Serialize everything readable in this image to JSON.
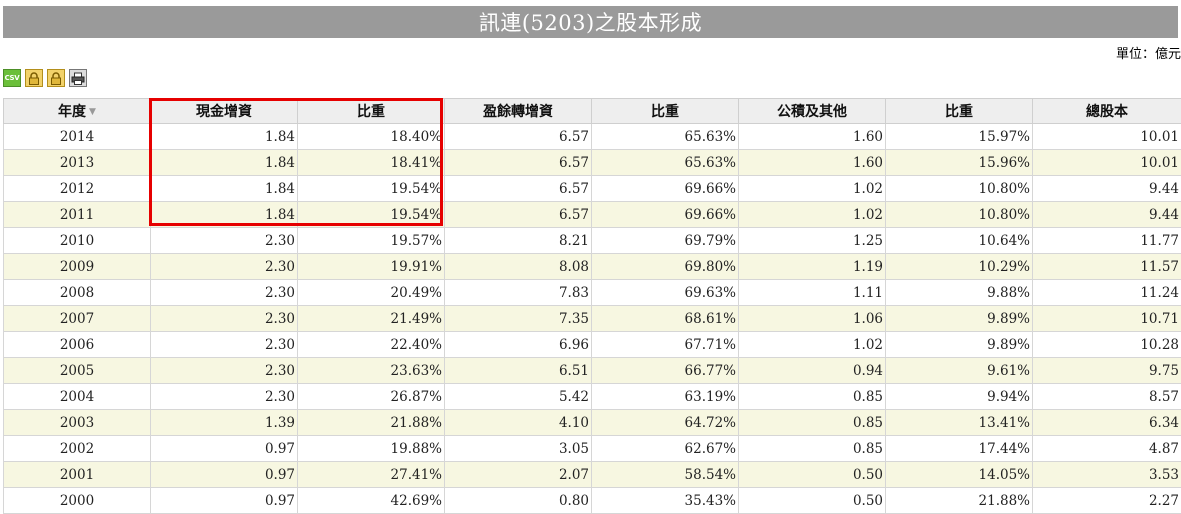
{
  "title": "訊連(5203)之股本形成",
  "unit_label": "單位：億元",
  "toolbar": {
    "csv_label": "CSV"
  },
  "table": {
    "headers": [
      "年度",
      "現金增資",
      "比重",
      "盈餘轉增資",
      "比重",
      "公積及其他",
      "比重",
      "總股本"
    ],
    "rows": [
      [
        "2014",
        "1.84",
        "18.40%",
        "6.57",
        "65.63%",
        "1.60",
        "15.97%",
        "10.01"
      ],
      [
        "2013",
        "1.84",
        "18.41%",
        "6.57",
        "65.63%",
        "1.60",
        "15.96%",
        "10.01"
      ],
      [
        "2012",
        "1.84",
        "19.54%",
        "6.57",
        "69.66%",
        "1.02",
        "10.80%",
        "9.44"
      ],
      [
        "2011",
        "1.84",
        "19.54%",
        "6.57",
        "69.66%",
        "1.02",
        "10.80%",
        "9.44"
      ],
      [
        "2010",
        "2.30",
        "19.57%",
        "8.21",
        "69.79%",
        "1.25",
        "10.64%",
        "11.77"
      ],
      [
        "2009",
        "2.30",
        "19.91%",
        "8.08",
        "69.80%",
        "1.19",
        "10.29%",
        "11.57"
      ],
      [
        "2008",
        "2.30",
        "20.49%",
        "7.83",
        "69.63%",
        "1.11",
        "9.88%",
        "11.24"
      ],
      [
        "2007",
        "2.30",
        "21.49%",
        "7.35",
        "68.61%",
        "1.06",
        "9.89%",
        "10.71"
      ],
      [
        "2006",
        "2.30",
        "22.40%",
        "6.96",
        "67.71%",
        "1.02",
        "9.89%",
        "10.28"
      ],
      [
        "2005",
        "2.30",
        "23.63%",
        "6.51",
        "66.77%",
        "0.94",
        "9.61%",
        "9.75"
      ],
      [
        "2004",
        "2.30",
        "26.87%",
        "5.42",
        "63.19%",
        "0.85",
        "9.94%",
        "8.57"
      ],
      [
        "2003",
        "1.39",
        "21.88%",
        "4.10",
        "64.72%",
        "0.85",
        "13.41%",
        "6.34"
      ],
      [
        "2002",
        "0.97",
        "19.88%",
        "3.05",
        "62.67%",
        "0.85",
        "17.44%",
        "4.87"
      ],
      [
        "2001",
        "0.97",
        "27.41%",
        "2.07",
        "58.54%",
        "0.50",
        "14.05%",
        "3.53"
      ],
      [
        "2000",
        "0.97",
        "42.69%",
        "0.80",
        "35.43%",
        "0.50",
        "21.88%",
        "2.27"
      ]
    ]
  },
  "colors": {
    "title_bg": "#9a9a9a",
    "header_bg": "#eeeeee",
    "row_alt_bg": "#f7f7e1",
    "highlight_border": "#e60000"
  },
  "icons": {
    "csv": "csv-export-icon",
    "lock1": "lock-icon",
    "lock2": "lock-icon",
    "print": "printer-icon"
  }
}
